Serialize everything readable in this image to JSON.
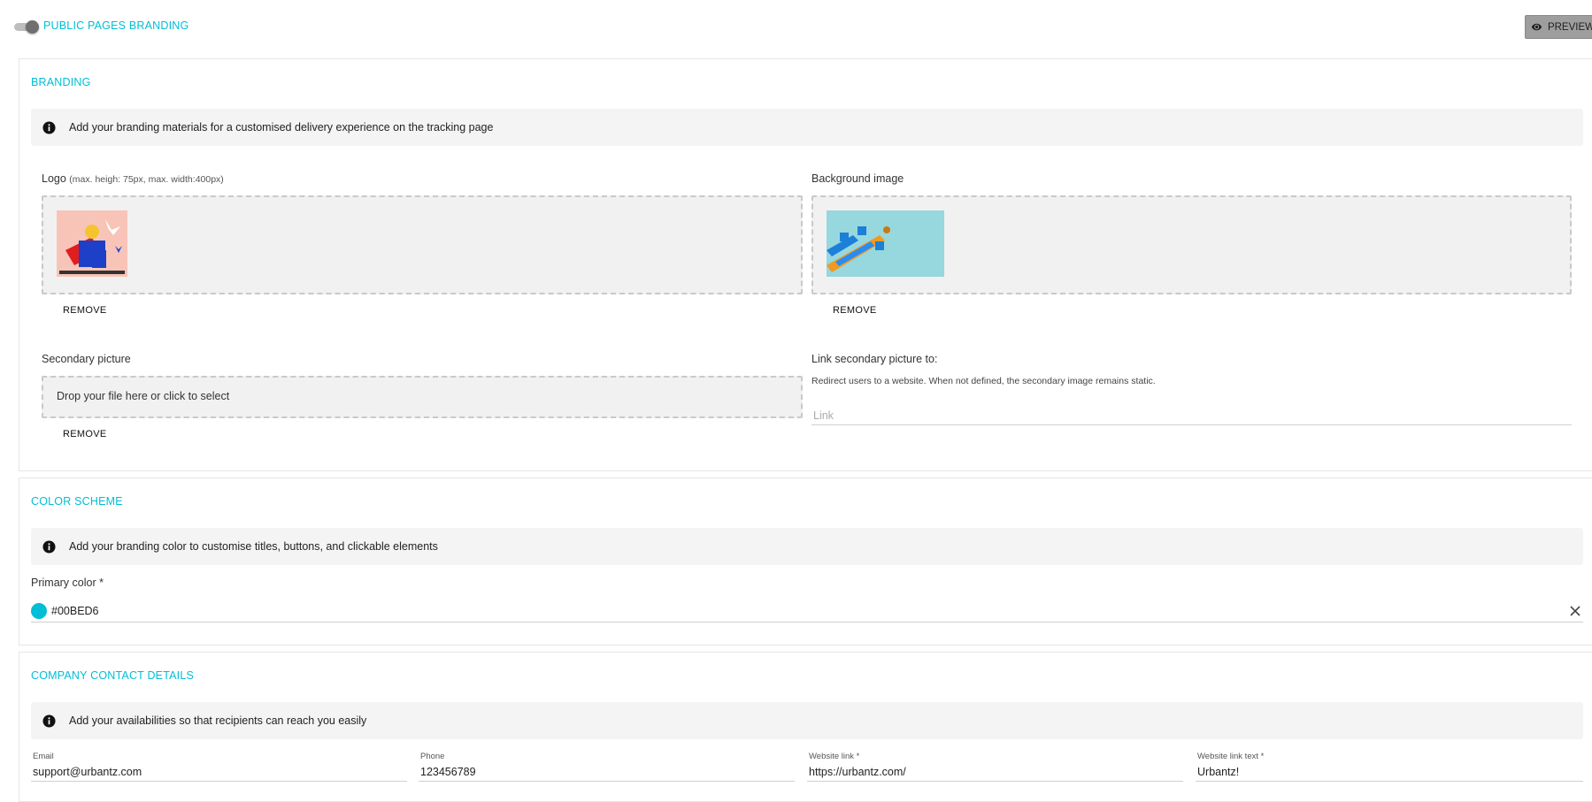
{
  "header": {
    "toggle_label": "PUBLIC PAGES BRANDING",
    "preview_label": "PREVIEW"
  },
  "branding": {
    "title": "BRANDING",
    "info": "Add your branding materials for a customised delivery experience on the tracking page",
    "logo_label": "Logo",
    "logo_hint": "(max. heigh: 75px, max. width:400px)",
    "logo_remove": "REMOVE",
    "background_label": "Background image",
    "background_remove": "REMOVE",
    "secondary_label": "Secondary picture",
    "secondary_drop_text": "Drop your file here or click to select",
    "secondary_remove": "REMOVE",
    "link_label": "Link secondary picture to:",
    "link_note": "Redirect users to a website. When not defined, the secondary image remains static.",
    "link_placeholder": "Link"
  },
  "color_scheme": {
    "title": "COLOR SCHEME",
    "info": "Add your branding color to customise titles, buttons, and clickable elements",
    "primary_label": "Primary color *",
    "primary_value": "#00BED6",
    "primary_color": "#00BED6"
  },
  "contact": {
    "title": "COMPANY CONTACT DETAILS",
    "info": "Add your availabilities so that recipients can reach you easily",
    "fields": [
      {
        "label": "Email",
        "value": "support@urbantz.com"
      },
      {
        "label": "Phone",
        "value": "123456789"
      },
      {
        "label": "Website link *",
        "value": "https://urbantz.com/"
      },
      {
        "label": "Website link text *",
        "value": "Urbantz!"
      }
    ]
  },
  "icons": {
    "toggle": "toggle-switch",
    "preview": "eye-icon",
    "info": "info-icon",
    "clear": "close-icon"
  }
}
